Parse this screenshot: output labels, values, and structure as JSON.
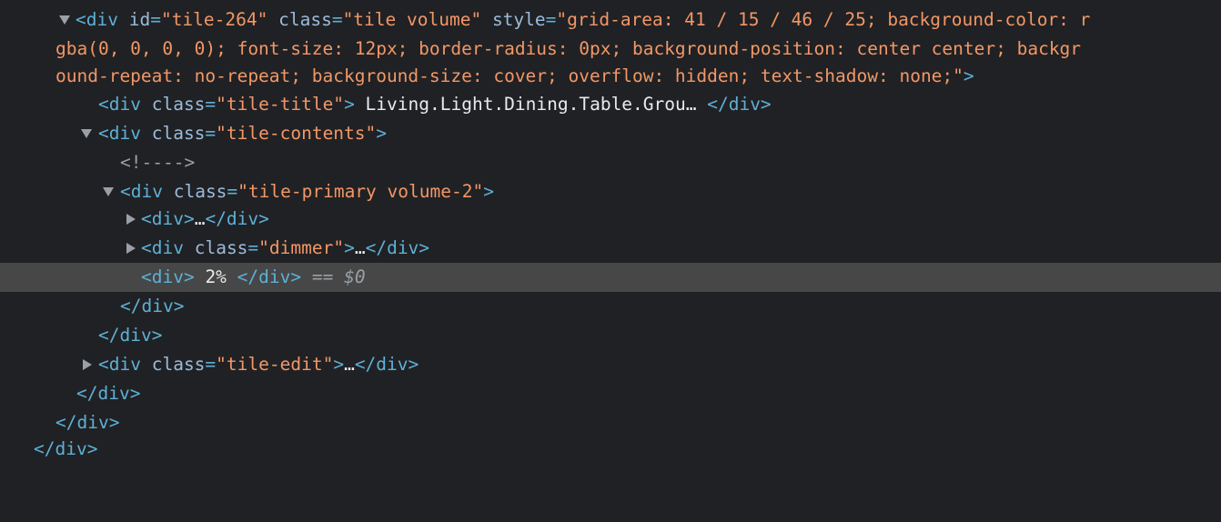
{
  "elements_tree": {
    "tile_open_tag": {
      "open": "<div",
      "id_attr": "id",
      "id_value": "\"tile-264\"",
      "class_attr": "class",
      "class_value": "\"tile volume\"",
      "style_attr": "style",
      "style_value_line1": "\"grid-area: 41 / 15 / 46 / 25; background-color: r",
      "style_value_line2": "gba(0, 0, 0, 0); font-size: 12px; border-radius: 0px; background-position: center center; backgr",
      "style_value_line3": "ound-repeat: no-repeat; background-size: cover; overflow: hidden; text-shadow: none;\"",
      "close": ">"
    },
    "tile_title": {
      "open": "<div",
      "class_attr": "class",
      "class_value": "\"tile-title\"",
      "gt": ">",
      "text": " Living.Light.Dining.Table.Grou… ",
      "close": "</div>"
    },
    "tile_contents": {
      "open": "<div",
      "class_attr": "class",
      "class_value": "\"tile-contents\"",
      "gt": ">"
    },
    "comment": "<!---->",
    "tile_primary": {
      "open": "<div",
      "class_attr": "class",
      "class_value": "\"tile-primary volume-2\"",
      "gt": ">"
    },
    "collapsed_div": {
      "open": "<div>",
      "ellipsis": "…",
      "close": "</div>"
    },
    "dimmer": {
      "open": "<div",
      "class_attr": "class",
      "class_value": "\"dimmer\"",
      "gt": ">",
      "ellipsis": "…",
      "close": "</div>"
    },
    "selected_node": {
      "open": "<div>",
      "text": " 2% ",
      "close": "</div>",
      "eq": " == ",
      "ref": "$0"
    },
    "close_tile_primary": "</div>",
    "close_tile_contents": "</div>",
    "tile_edit": {
      "open": "<div",
      "class_attr": "class",
      "class_value": "\"tile-edit\"",
      "gt": ">",
      "ellipsis": "…",
      "close": "</div>"
    },
    "close_tile": "</div>",
    "close_outer": "</div>",
    "close_partial": "</div>"
  },
  "colors": {
    "background": "#202124",
    "selected_row": "#474747",
    "tag": "#5db0d7",
    "attribute_name": "#9bbbdc",
    "attribute_value": "#f29766",
    "text": "#e8eaed",
    "comment": "#9aa0a6"
  },
  "icons": {
    "expanded": "triangle-down-icon",
    "collapsed": "triangle-right-icon"
  }
}
